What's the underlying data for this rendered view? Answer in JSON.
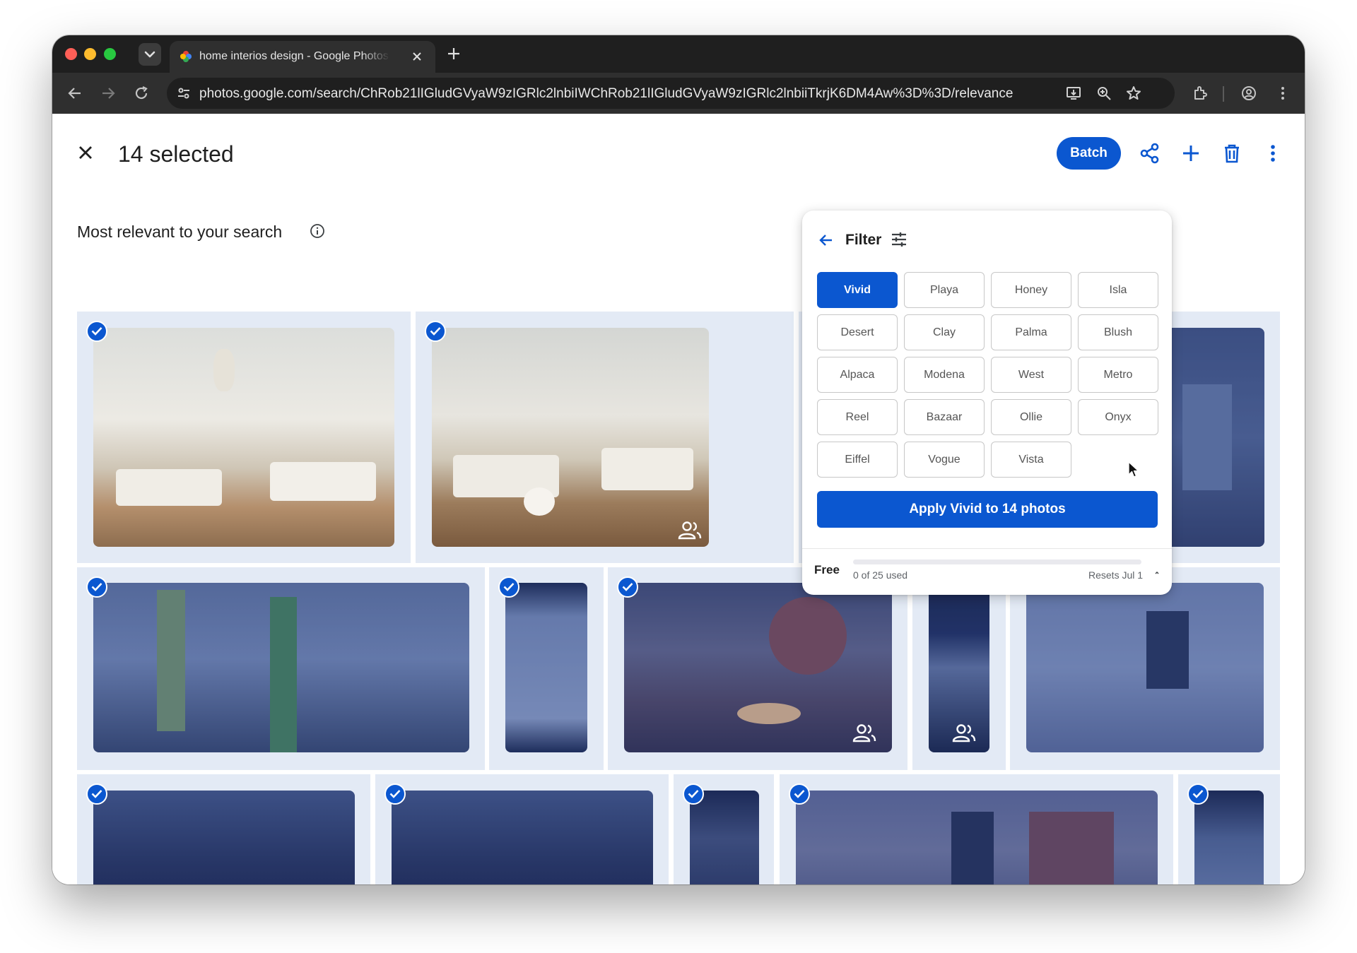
{
  "browser": {
    "tab_title": "home interios design - Google Photos",
    "url": "photos.google.com/search/ChRob21lIGludGVyaW9zIGRlc2lnbiIWChRob21lIGludGVyaW9zIGRlc2lnbiiTkrjK6DM4Aw%3D%3D/relevance",
    "icons": [
      "tab-list-icon",
      "google-photos-favicon",
      "close-tab-icon",
      "new-tab-icon",
      "back-arrow-icon",
      "forward-arrow-icon",
      "reload-icon",
      "site-settings-icon",
      "install-app-icon",
      "zoom-icon",
      "bookmark-star-icon",
      "extensions-icon",
      "profile-icon",
      "browser-menu-icon"
    ]
  },
  "header": {
    "selected_count": "14 selected",
    "batch_label": "Batch",
    "icons": [
      "close-icon",
      "share-icon",
      "add-icon",
      "trash-icon",
      "more-vert-icon"
    ]
  },
  "section": {
    "title": "Most relevant to your search",
    "icon": "info-icon"
  },
  "filter": {
    "title": "Filter",
    "icons": [
      "back-arrow-icon",
      "tune-icon"
    ],
    "options": [
      "Vivid",
      "Playa",
      "Honey",
      "Isla",
      "Desert",
      "Clay",
      "Palma",
      "Blush",
      "Alpaca",
      "Modena",
      "West",
      "Metro",
      "Reel",
      "Bazaar",
      "Ollie",
      "Onyx",
      "Eiffel",
      "Vogue",
      "Vista"
    ],
    "selected": "Vivid",
    "apply_label": "Apply Vivid to 14 photos",
    "plan": "Free",
    "usage_text": "0 of 25 used",
    "usage_fraction": 0,
    "resets": "Resets Jul 1"
  },
  "colors": {
    "accent": "#0b57d0",
    "selection_overlay": "#e3eaf5",
    "browser_dark": "#1f1f1f"
  }
}
